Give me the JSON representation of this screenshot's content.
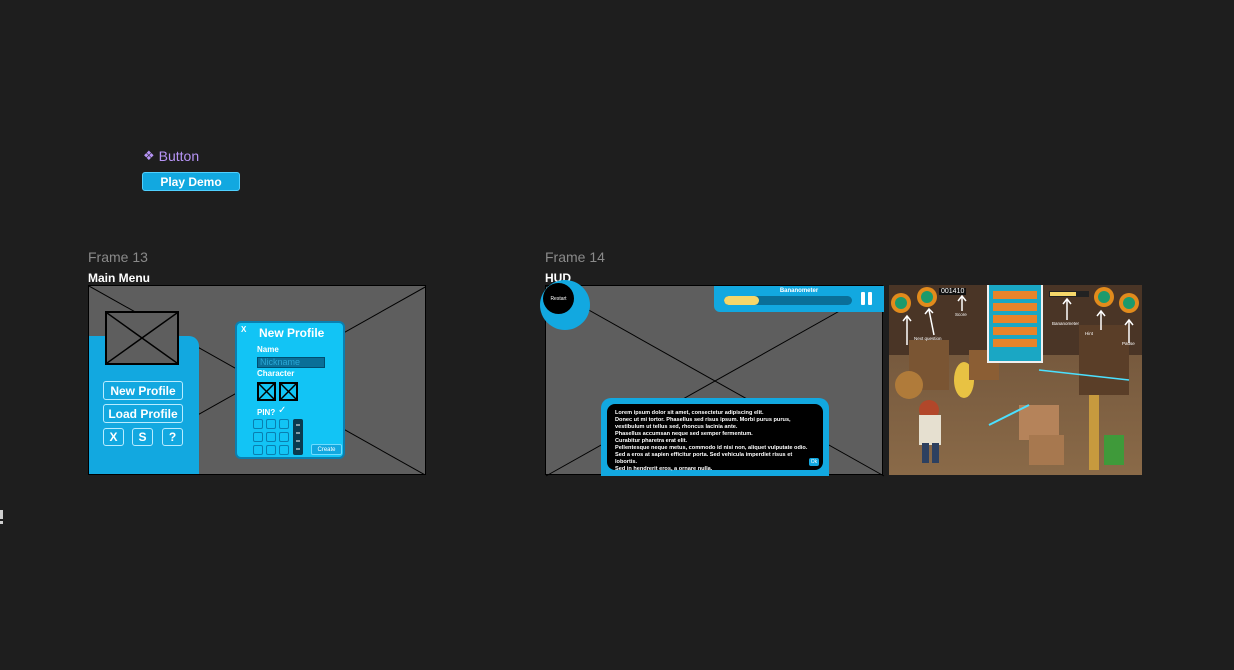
{
  "component": {
    "title": "Button",
    "icon": "component-diamond-icon",
    "button_label": "Play Demo",
    "accent": "#b794f6",
    "button_color": "#12a8e0"
  },
  "frame13": {
    "label": "Frame 13",
    "name": "Main Menu",
    "buttons": {
      "new_profile": "New Profile",
      "load_profile": "Load Profile",
      "x": "X",
      "s": "S",
      "help": "?"
    },
    "new_profile_dialog": {
      "close": "X",
      "title": "New Profile",
      "name_label": "Name",
      "nickname_placeholder": "Nickname",
      "character_label": "Character",
      "pin_label": "PIN?",
      "create_label": "Create"
    }
  },
  "frame14": {
    "label": "Frame 14",
    "name": "HUD",
    "restart_label": "Restart",
    "bananometer_label": "Bananometer",
    "bananometer_level": 0.27,
    "dialog_lines": [
      "Lorem ipsum dolor sit amet, consectetur adipiscing elit.",
      "Donec ut mi tortor. Phasellus sed risus ipsum. Morbi purus purus,",
      "vestibulum ut tellus sed, rhoncus lacinia ante.",
      "Phasellus accumsan neque sed semper fermentum.",
      "Curabitur pharetra erat elit.",
      "Pellentesque neque metus, commodo id nisi non, aliquet vulputate odio.",
      "Sed a eros at sapien efficitur porta. Sed vehicula imperdiet risus et lobortis.",
      "Sed in hendrerit eros, a ornare nulla."
    ],
    "ok_label": "Ok"
  },
  "screenshot": {
    "score": "001410",
    "annotations": {
      "score": "Score",
      "bananometer": "Bananometer",
      "next_question": "Next question",
      "hint": "Hint",
      "pause": "Pause"
    }
  }
}
